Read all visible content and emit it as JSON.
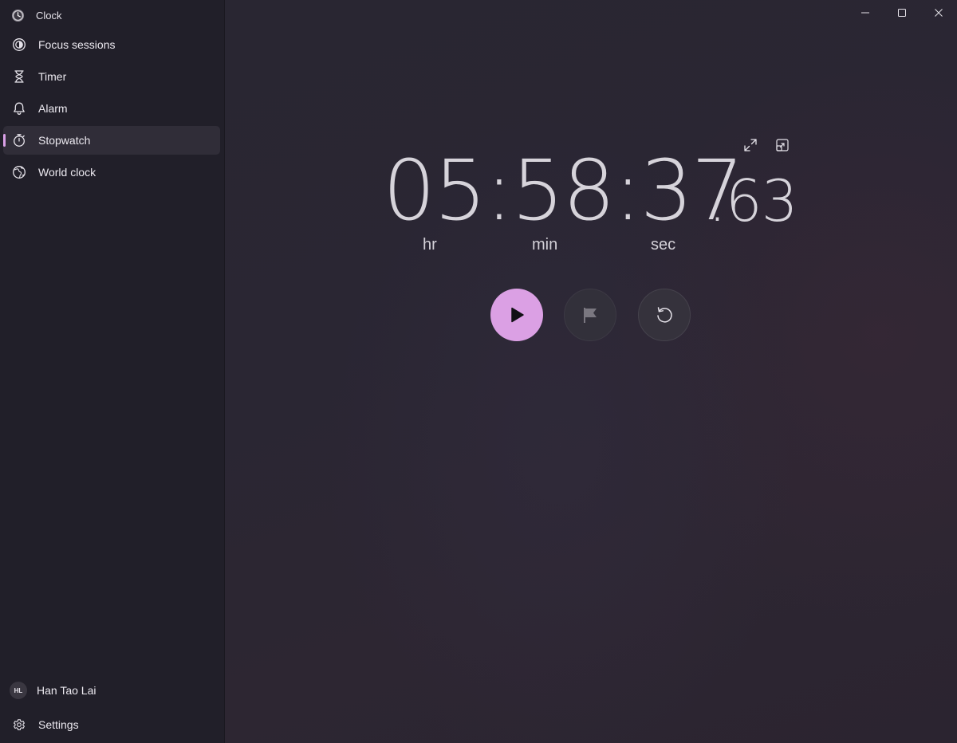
{
  "app": {
    "title": "Clock"
  },
  "sidebar": {
    "items": [
      {
        "label": "Focus sessions",
        "icon": "focus-icon"
      },
      {
        "label": "Timer",
        "icon": "hourglass-icon"
      },
      {
        "label": "Alarm",
        "icon": "bell-icon"
      },
      {
        "label": "Stopwatch",
        "icon": "stopwatch-icon",
        "active": true
      },
      {
        "label": "World clock",
        "icon": "globe-icon"
      }
    ],
    "profile": {
      "initials": "HL",
      "name": "Han Tao Lai"
    },
    "settings_label": "Settings"
  },
  "stopwatch": {
    "time_main": "05:58:37",
    "time_fraction": ".63",
    "units": {
      "hours": "hr",
      "minutes": "min",
      "seconds": "sec"
    },
    "controls": [
      "play-icon",
      "flag-icon",
      "reset-icon"
    ],
    "view_controls": [
      "expand-icon",
      "compact-overlay-icon"
    ]
  },
  "colors": {
    "accent": "#dba0e4",
    "sidebar_bg": "#211f29",
    "selected_item_bg": "#302d38",
    "main_bg": "#292632"
  }
}
